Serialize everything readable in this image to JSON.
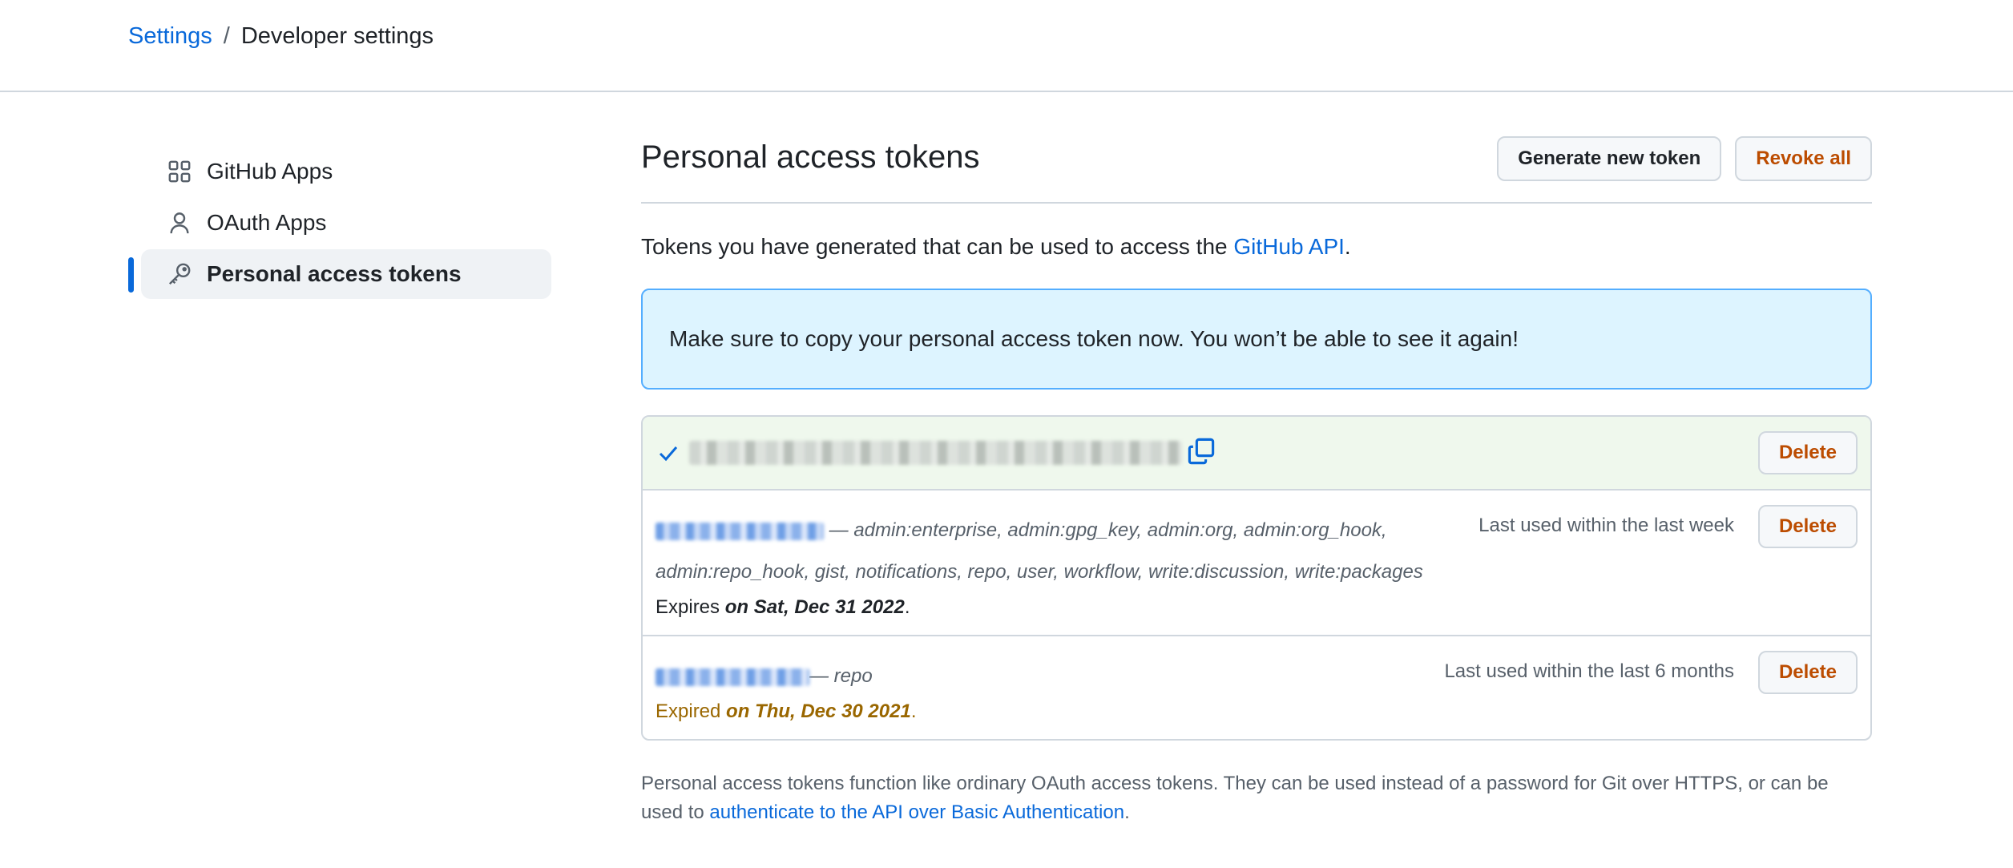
{
  "breadcrumb": {
    "root": "Settings",
    "separator": "/",
    "current": "Developer settings"
  },
  "sidebar": {
    "items": [
      {
        "label": "GitHub Apps",
        "icon": "apps-grid-icon",
        "active": false
      },
      {
        "label": "OAuth Apps",
        "icon": "person-icon",
        "active": false
      },
      {
        "label": "Personal access tokens",
        "icon": "key-icon",
        "active": true
      }
    ]
  },
  "main": {
    "title": "Personal access tokens",
    "generate_label": "Generate new token",
    "revoke_label": "Revoke all",
    "intro_text": "Tokens you have generated that can be used to access the ",
    "intro_link": "GitHub API",
    "intro_end": ".",
    "flash_message": "Make sure to copy your personal access token now. You won’t be able to see it again!",
    "delete_label": "Delete",
    "tokens": [
      {
        "scopes": " — admin:enterprise, admin:gpg_key, admin:org, admin:org_hook, admin:repo_hook, gist, notifications, repo, user, workflow, write:discussion, write:packages",
        "last_used": "Last used within the last week",
        "expires_prefix": "Expires ",
        "expires_date": "on Sat, Dec 31 2022",
        "expires_suffix": "."
      },
      {
        "scopes": "— repo",
        "last_used": "Last used within the last 6 months",
        "expires_prefix": "Expired ",
        "expires_date": "on Thu, Dec 30 2021",
        "expires_suffix": "."
      }
    ],
    "footnote_text": "Personal access tokens function like ordinary OAuth access tokens. They can be used instead of a password for Git over HTTPS, or can be used to ",
    "footnote_link": "authenticate to the API over Basic Authentication",
    "footnote_end": "."
  },
  "colors": {
    "accent": "#0969da",
    "danger": "#bc4c00",
    "flash_bg": "#ddf4ff",
    "new_token_bg": "#eff8ed",
    "expired": "#9a6700"
  }
}
